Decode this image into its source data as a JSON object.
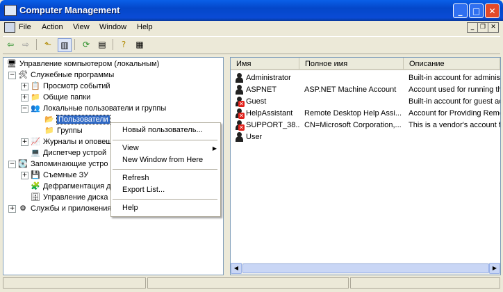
{
  "window": {
    "title": "Computer Management",
    "controls": [
      "_",
      "□",
      "✕"
    ]
  },
  "menu": [
    "File",
    "Action",
    "View",
    "Window",
    "Help"
  ],
  "tree": {
    "root": "Управление компьютером (локальным)",
    "nodes": [
      "Служебные программы",
      "Просмотр событий",
      "Общие папки",
      "Локальные пользователи и группы",
      "Пользователи",
      "Группы",
      "Журналы и оповещ",
      "Диспетчер устрой",
      "Запоминающие устро",
      "Съемные ЗУ",
      "Дефрагментация д",
      "Управление диска",
      "Службы и приложения"
    ]
  },
  "context_menu": {
    "items": [
      "Новый пользователь...",
      "View",
      "New Window from Here",
      "Refresh",
      "Export List...",
      "Help"
    ]
  },
  "list": {
    "columns": [
      "Имя",
      "Полное имя",
      "Описание"
    ],
    "rows": [
      {
        "name": "Administrator",
        "full": "",
        "desc": "Built-in account for administ",
        "disabled": false
      },
      {
        "name": "ASPNET",
        "full": "ASP.NET Machine Account",
        "desc": "Account used for running th",
        "disabled": false
      },
      {
        "name": "Guest",
        "full": "",
        "desc": "Built-in account for guest ac",
        "disabled": true
      },
      {
        "name": "HelpAssistant",
        "full": "Remote Desktop Help Assi...",
        "desc": "Account for Providing Remo",
        "disabled": true
      },
      {
        "name": "SUPPORT_38...",
        "full": "CN=Microsoft Corporation,...",
        "desc": "This is a vendor's account fo",
        "disabled": true
      },
      {
        "name": "User",
        "full": "",
        "desc": "",
        "disabled": false
      }
    ]
  }
}
